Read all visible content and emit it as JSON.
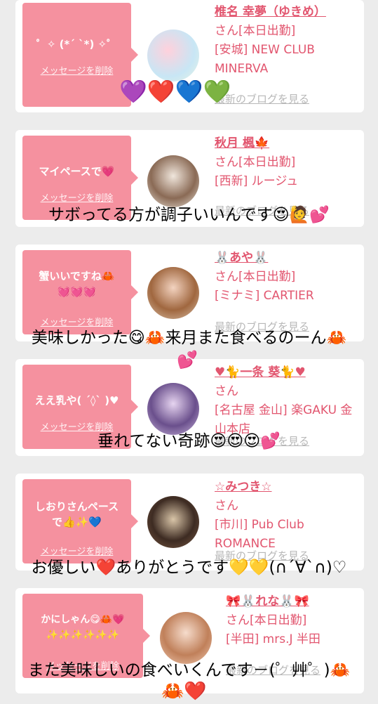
{
  "cards": [
    {
      "bubble_message": "゜✧ (*´ `*) ✧゜",
      "delete_label": "メッセージを削除",
      "name": "椎名 幸夢（ゆきめ）",
      "status": "さん[本日出勤]",
      "shop": "[安城] NEW CLUB MINERVA",
      "blog_link": "最新のブログを見る"
    },
    {
      "bubble_message": "マイペースで💗",
      "delete_label": "メッセージを削除",
      "name": "秋月 楓🍁",
      "status": "さん[本日出勤]",
      "shop": "[西新] ルージュ",
      "blog_link": "最新のブログを見る"
    },
    {
      "bubble_message": "蟹いいですね🦀💓💓💓",
      "delete_label": "メッセージを削除",
      "name": "🐰あや🐰",
      "status": "さん[本日出勤]",
      "shop": "[ミナミ] CARTIER",
      "blog_link": "最新のブログを見る"
    },
    {
      "bubble_message": "ええ乳や( ´◊` )♥",
      "delete_label": "メッセージを削除",
      "name": "♥🐈一条 葵🐈♥",
      "status": "さん",
      "shop": "[名古屋 金山] 楽GAKU 金山本店",
      "blog_link": "最新のブログを見る"
    },
    {
      "bubble_message": "しおりさんペースで👍✨💙",
      "delete_label": "メッセージを削除",
      "name": "☆みつき☆",
      "status": "さん",
      "shop": "[市川] Pub Club ROMANCE",
      "blog_link": "最新のブログを見る"
    },
    {
      "bubble_message": "かにしゃん😋🦀💗✨✨✨✨✨✨",
      "delete_label": "メッセージを削除",
      "name": "🎀🐰れな🐰🎀",
      "status": "さん[本日出勤]",
      "shop": "[半田] mrs.J 半田",
      "blog_link": "最新のブログを見る"
    }
  ],
  "overlays": {
    "hearts_row": "💜❤️💙💚",
    "line1": "サボってる方が調子いいんです😍🙋💕",
    "line2": "美味しかった😋🦀来月また食べるのーん🦀",
    "line2b": "💕",
    "line3": "垂れてない奇跡😍😍😍💕",
    "line4": "お優しい❤️ありがとうです💛💛(∩´∀`∩)♡",
    "line5": "また美味しいの食べいくんです－(゜艸゜)🦀",
    "line5b": "🦀❤️"
  }
}
